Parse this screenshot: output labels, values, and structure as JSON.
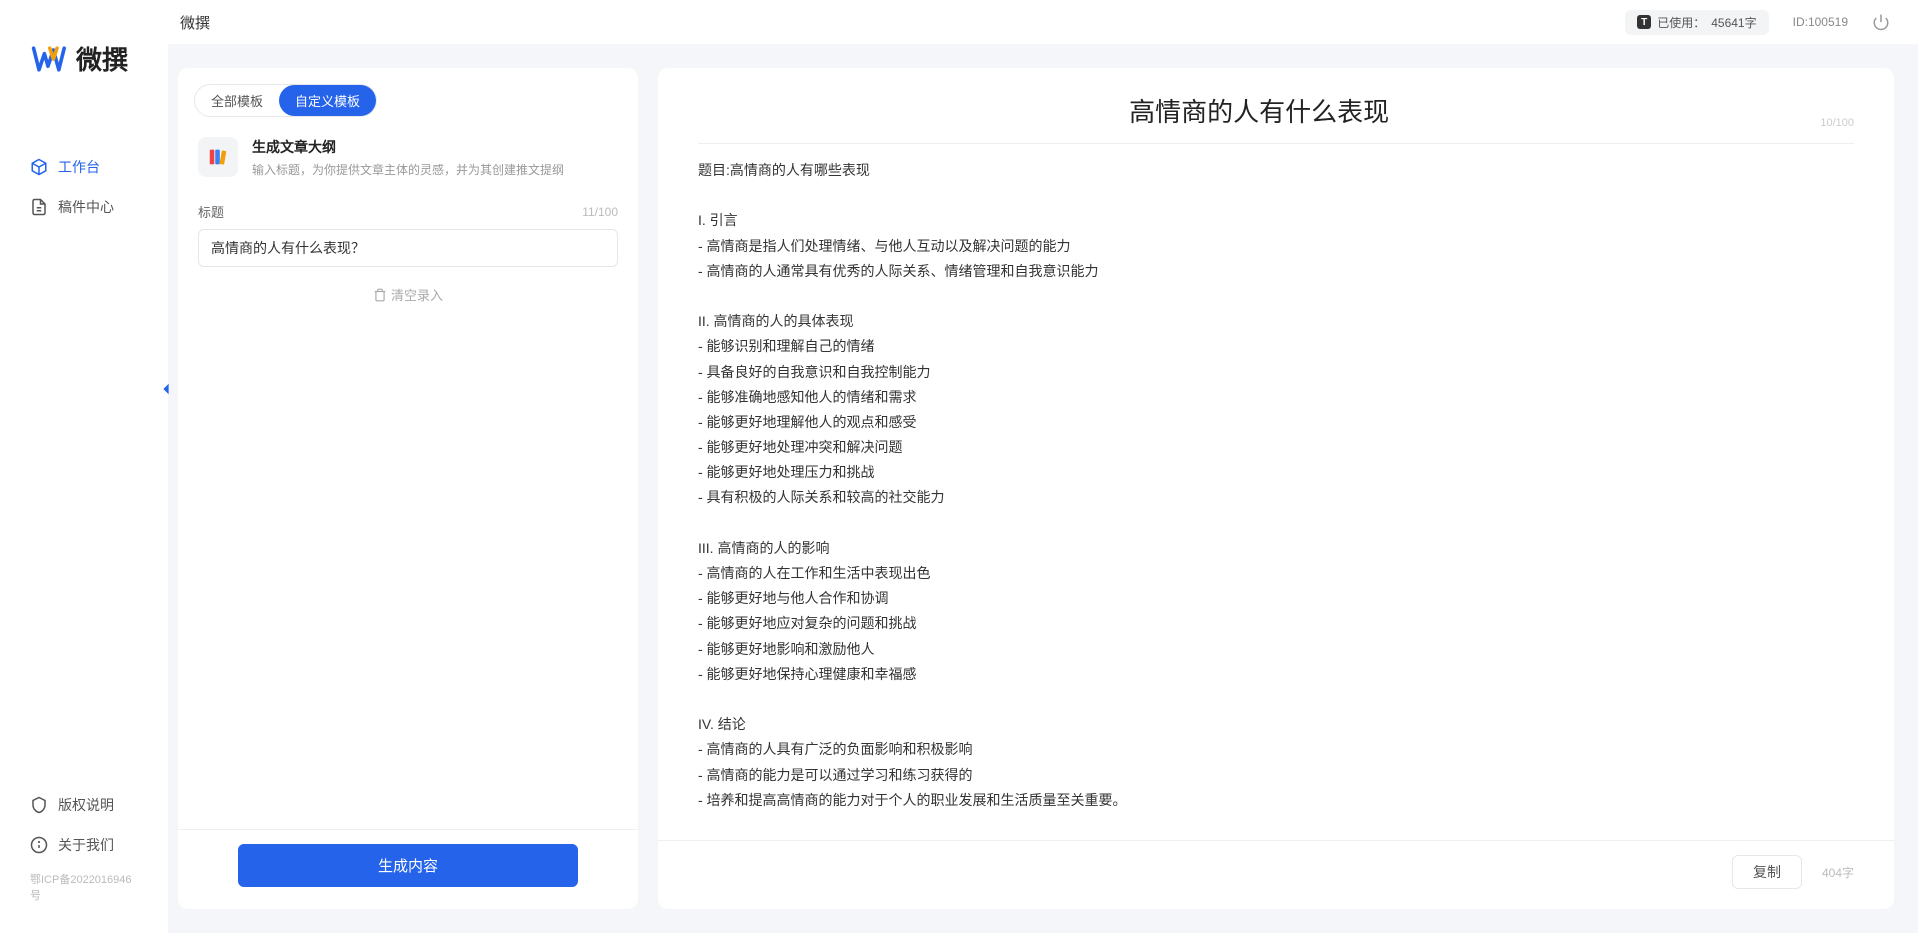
{
  "app": {
    "name": "微撰",
    "logo_text": "微撰"
  },
  "sidebar": {
    "nav": [
      {
        "label": "工作台",
        "active": true
      },
      {
        "label": "稿件中心",
        "active": false
      }
    ],
    "bottom": [
      {
        "label": "版权说明"
      },
      {
        "label": "关于我们"
      }
    ],
    "icp": "鄂ICP备2022016946号"
  },
  "topbar": {
    "title": "微撰",
    "usage_prefix": "已使用：",
    "usage_value": "45641字",
    "user_id_label": "ID:100519"
  },
  "left": {
    "tabs": [
      {
        "label": "全部模板",
        "active": false
      },
      {
        "label": "自定义模板",
        "active": true
      }
    ],
    "template": {
      "title": "生成文章大纲",
      "desc": "输入标题，为你提供文章主体的灵感，并为其创建推文提纲"
    },
    "field": {
      "label": "标题",
      "count": "11/100",
      "value": "高情商的人有什么表现？"
    },
    "clear_label": "清空录入",
    "generate_label": "生成内容"
  },
  "right": {
    "title": "高情商的人有什么表现",
    "title_count": "10/100",
    "body": "题目:高情商的人有哪些表现\n\nI. 引言\n- 高情商是指人们处理情绪、与他人互动以及解决问题的能力\n- 高情商的人通常具有优秀的人际关系、情绪管理和自我意识能力\n\nII. 高情商的人的具体表现\n- 能够识别和理解自己的情绪\n- 具备良好的自我意识和自我控制能力\n- 能够准确地感知他人的情绪和需求\n- 能够更好地理解他人的观点和感受\n- 能够更好地处理冲突和解决问题\n- 能够更好地处理压力和挑战\n- 具有积极的人际关系和较高的社交能力\n\nIII. 高情商的人的影响\n- 高情商的人在工作和生活中表现出色\n- 能够更好地与他人合作和协调\n- 能够更好地应对复杂的问题和挑战\n- 能够更好地影响和激励他人\n- 能够更好地保持心理健康和幸福感\n\nIV. 结论\n- 高情商的人具有广泛的负面影响和积极影响\n- 高情商的能力是可以通过学习和练习获得的\n- 培养和提高高情商的能力对于个人的职业发展和生活质量至关重要。",
    "copy_label": "复制",
    "word_count": "404字"
  }
}
